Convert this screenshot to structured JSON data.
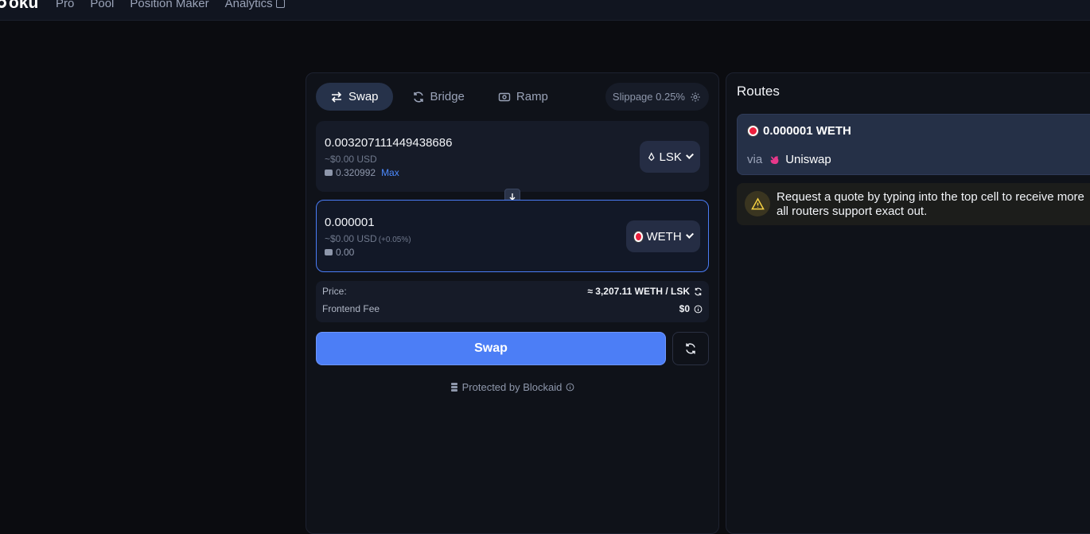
{
  "app": {
    "logo_text": "oku"
  },
  "nav": {
    "items": [
      "Pro",
      "Pool",
      "Position Maker",
      "Analytics"
    ]
  },
  "swap": {
    "tabs": [
      "Swap",
      "Bridge",
      "Ramp"
    ],
    "slippage_label": "Slippage 0.25%",
    "from": {
      "amount": "0.003207111449438686",
      "usd": "~$0.00 USD",
      "balance": "0.320992",
      "max_label": "Max",
      "token": "LSK"
    },
    "to": {
      "amount": "0.000001",
      "usd": "~$0.00 USD",
      "usd_change": "(+0.05%)",
      "balance": "0.00",
      "token": "WETH"
    },
    "price_label": "Price:",
    "price_value": "≈ 3,207.11 WETH / LSK",
    "fee_label": "Frontend Fee",
    "fee_value": "$0",
    "swap_button": "Swap",
    "protected_text": "Protected by Blockaid"
  },
  "routes": {
    "title": "Routes",
    "route": {
      "amount": "0.000001 WETH",
      "via_label": "via",
      "provider": "Uniswap"
    },
    "warning_line1": "Request a quote by typing into the top cell to receive more",
    "warning_line2": "all routers support exact out."
  },
  "colors": {
    "accent": "#4c7ef6",
    "background": "#0b0c10",
    "panel": "#0f1219"
  }
}
